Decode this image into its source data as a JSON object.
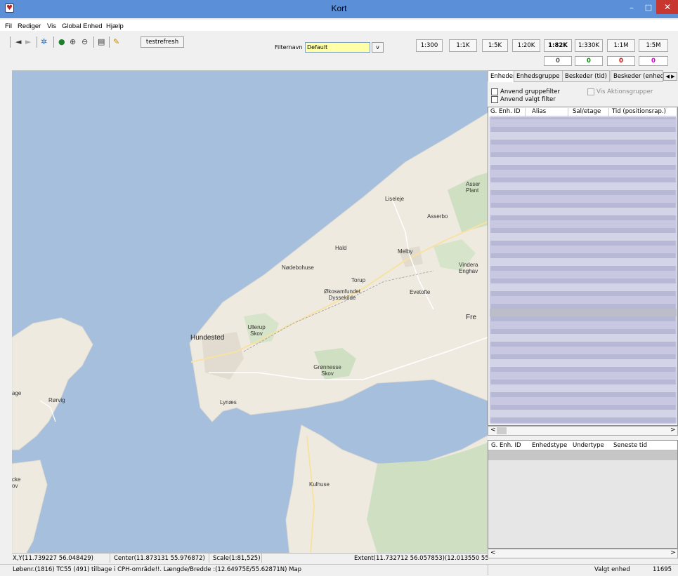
{
  "window": {
    "title": "Kort",
    "min": "–",
    "max": "□",
    "close": "✕"
  },
  "menu": [
    "Fil",
    "Rediger",
    "Vis",
    "Global Enhed",
    "Hjælp"
  ],
  "toolbar": {
    "refresh_label": "testrefresh"
  },
  "filter": {
    "label": "Filternavn",
    "value": "Default",
    "dropdown": "v"
  },
  "scale_buttons": [
    "1:300",
    "1:1K",
    "1:5K",
    "1:20K",
    "1:82K",
    "1:330K",
    "1:1M",
    "1:5M"
  ],
  "active_scale": "1:82K",
  "counters": [
    "0",
    "0",
    "0",
    "0"
  ],
  "counter_colors": [
    "#555555",
    "#0a8a0a",
    "#e00000",
    "#e000e0"
  ],
  "map": {
    "places": [
      "Liseleje",
      "Asserbo",
      "Asser Plant",
      "Hald",
      "Melby",
      "Nødebohuse",
      "Torup",
      "Økosamfundet Dyssekilde",
      "Evetofte",
      "Vindera Enghav",
      "Fre",
      "Hundested",
      "Ullerup Skov",
      "Grønnesse Skov",
      "Rørvig",
      "age",
      "Lynæs",
      "Kulhuse",
      "cke ov"
    ]
  },
  "map_status": {
    "xy": "X,Y(11.739227 56.048429)",
    "center": "Center(11.873131 55.976872)",
    "scale": "Scale(1:81,525)",
    "extent": "Extent(11.732712 56.057853)(12.013550 55"
  },
  "panel": {
    "tabs": [
      "Enheder",
      "Enhedsgruppe",
      "Beskeder (tid)",
      "Beskeder (enhed"
    ],
    "tab_scroll": "◀ ▶",
    "checks": [
      "Anvend gruppefilter",
      "Anvend valgt filter",
      "Vis Aktionsgrupper"
    ],
    "top_columns": [
      "G. Enh. ID",
      "Alias",
      "Sal/etage",
      "Tid (positionsrap.)"
    ],
    "bottom_columns": [
      "G. Enh. ID",
      "Enhedstype",
      "Undertype",
      "Seneste tid"
    ],
    "scroll_left": "<",
    "scroll_right": ">"
  },
  "status": {
    "message": "Løbenr.(1816) TC55 (491) tilbage i CPH-område!!. Længde/Bredde :(12.64975E/55.62871N) Map",
    "selected_label": "Valgt enhed",
    "selected_value": "11695"
  }
}
